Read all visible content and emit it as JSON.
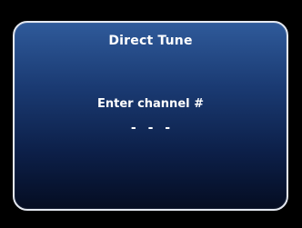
{
  "dialog": {
    "title": "Direct Tune",
    "prompt": "Enter channel #",
    "channel_entry": "- - -"
  }
}
